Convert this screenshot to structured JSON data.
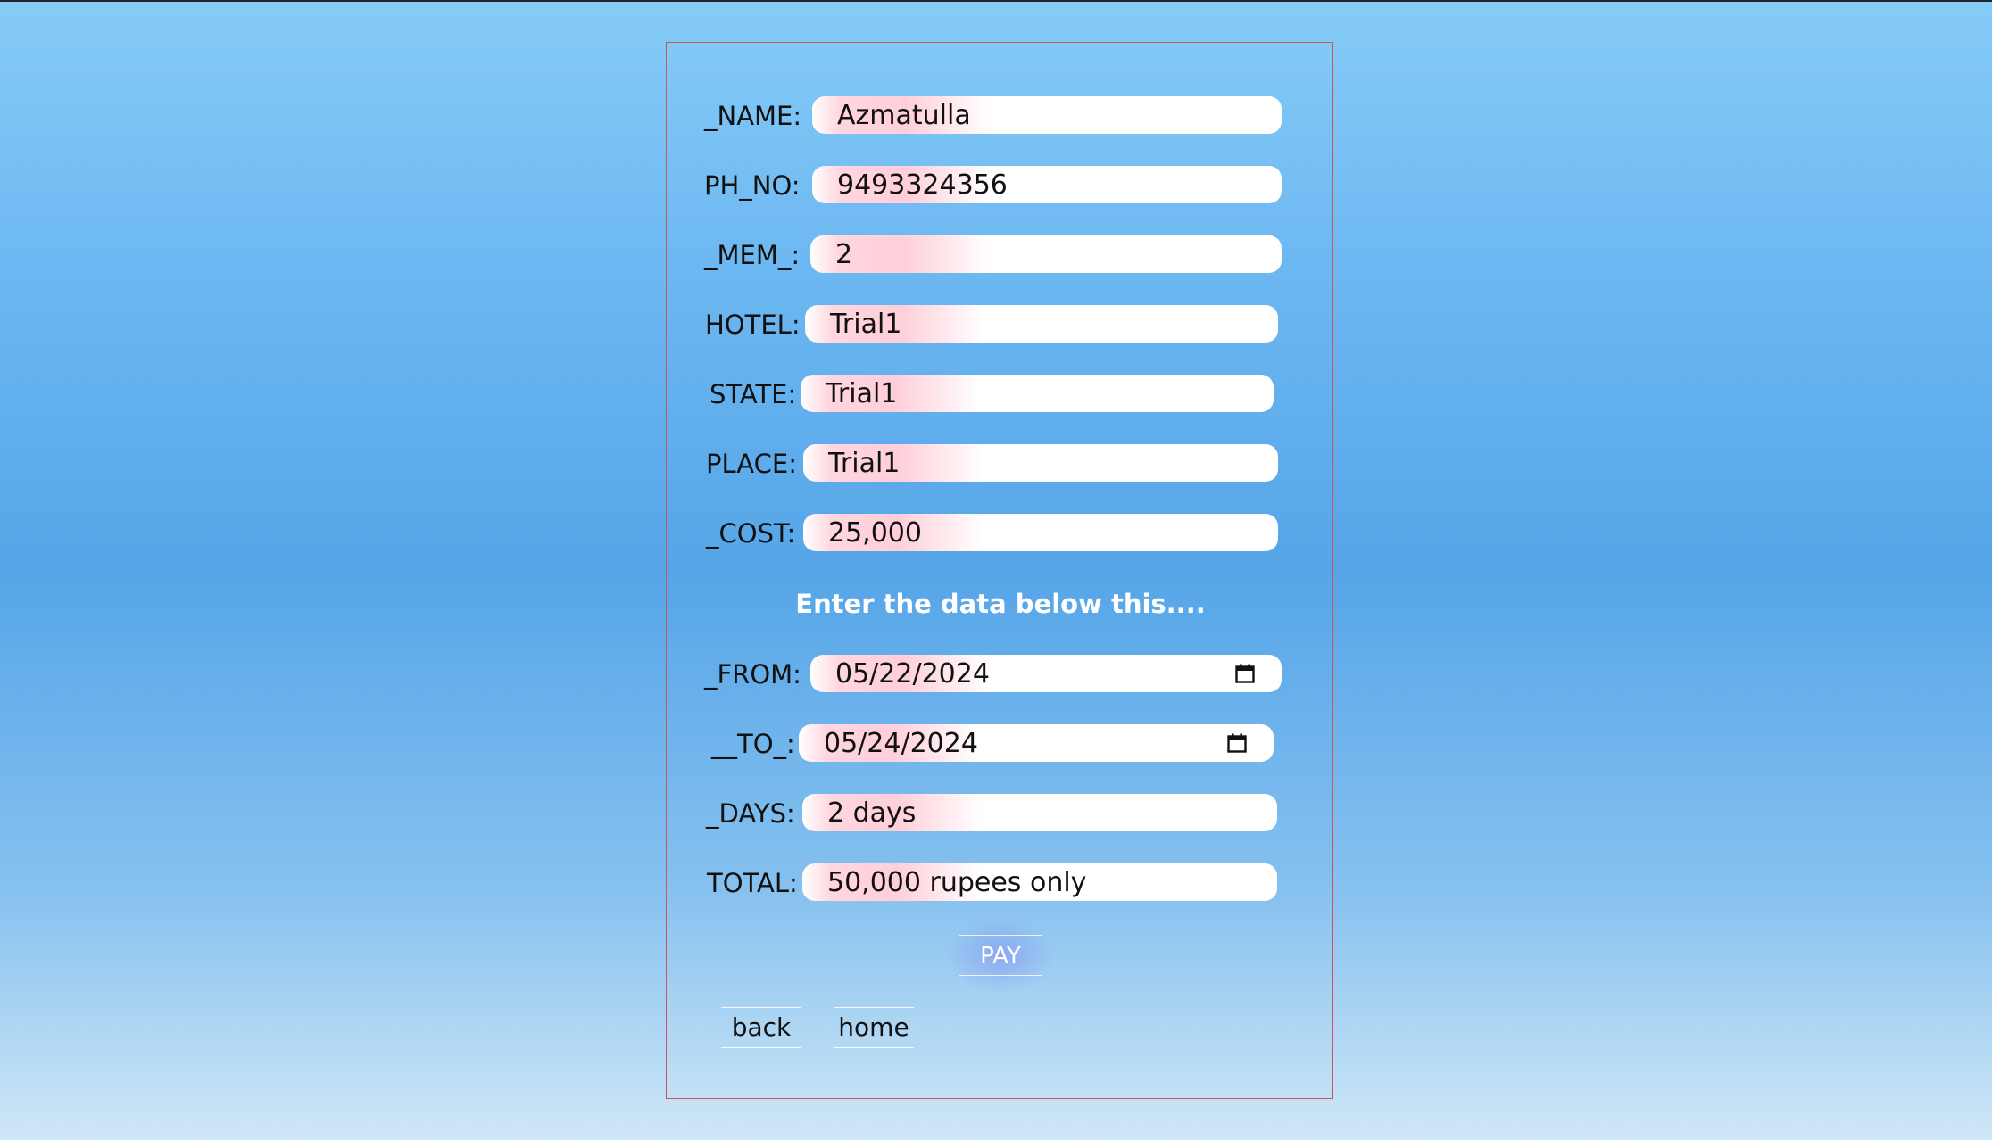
{
  "form": {
    "fields": [
      {
        "label": "_NAME:",
        "value": "Azmatulla"
      },
      {
        "label": "PH_NO:",
        "value": "9493324356"
      },
      {
        "label": "_MEM_:",
        "value": "2"
      },
      {
        "label": "HOTEL:",
        "value": "Trial1"
      },
      {
        "label": "STATE:",
        "value": "Trial1"
      },
      {
        "label": "PLACE:",
        "value": "Trial1"
      },
      {
        "label": "_COST:",
        "value": "25,000"
      }
    ],
    "note": "Enter the data below this....",
    "date_fields": [
      {
        "label": "_FROM:",
        "value": "05/22/2024",
        "icon": "calendar-icon"
      },
      {
        "label": "__TO_:",
        "value": "05/24/2024",
        "icon": "calendar-icon"
      }
    ],
    "result_fields": [
      {
        "label": "_DAYS:",
        "value": "2 days"
      },
      {
        "label": "TOTAL:",
        "value": "50,000 rupees only"
      }
    ]
  },
  "buttons": {
    "pay": "PAY",
    "back": "back",
    "home": "home"
  },
  "colors": {
    "card_border": "#c9546a",
    "field_highlight": "#ffcfd9",
    "note_text": "#ffffff"
  }
}
